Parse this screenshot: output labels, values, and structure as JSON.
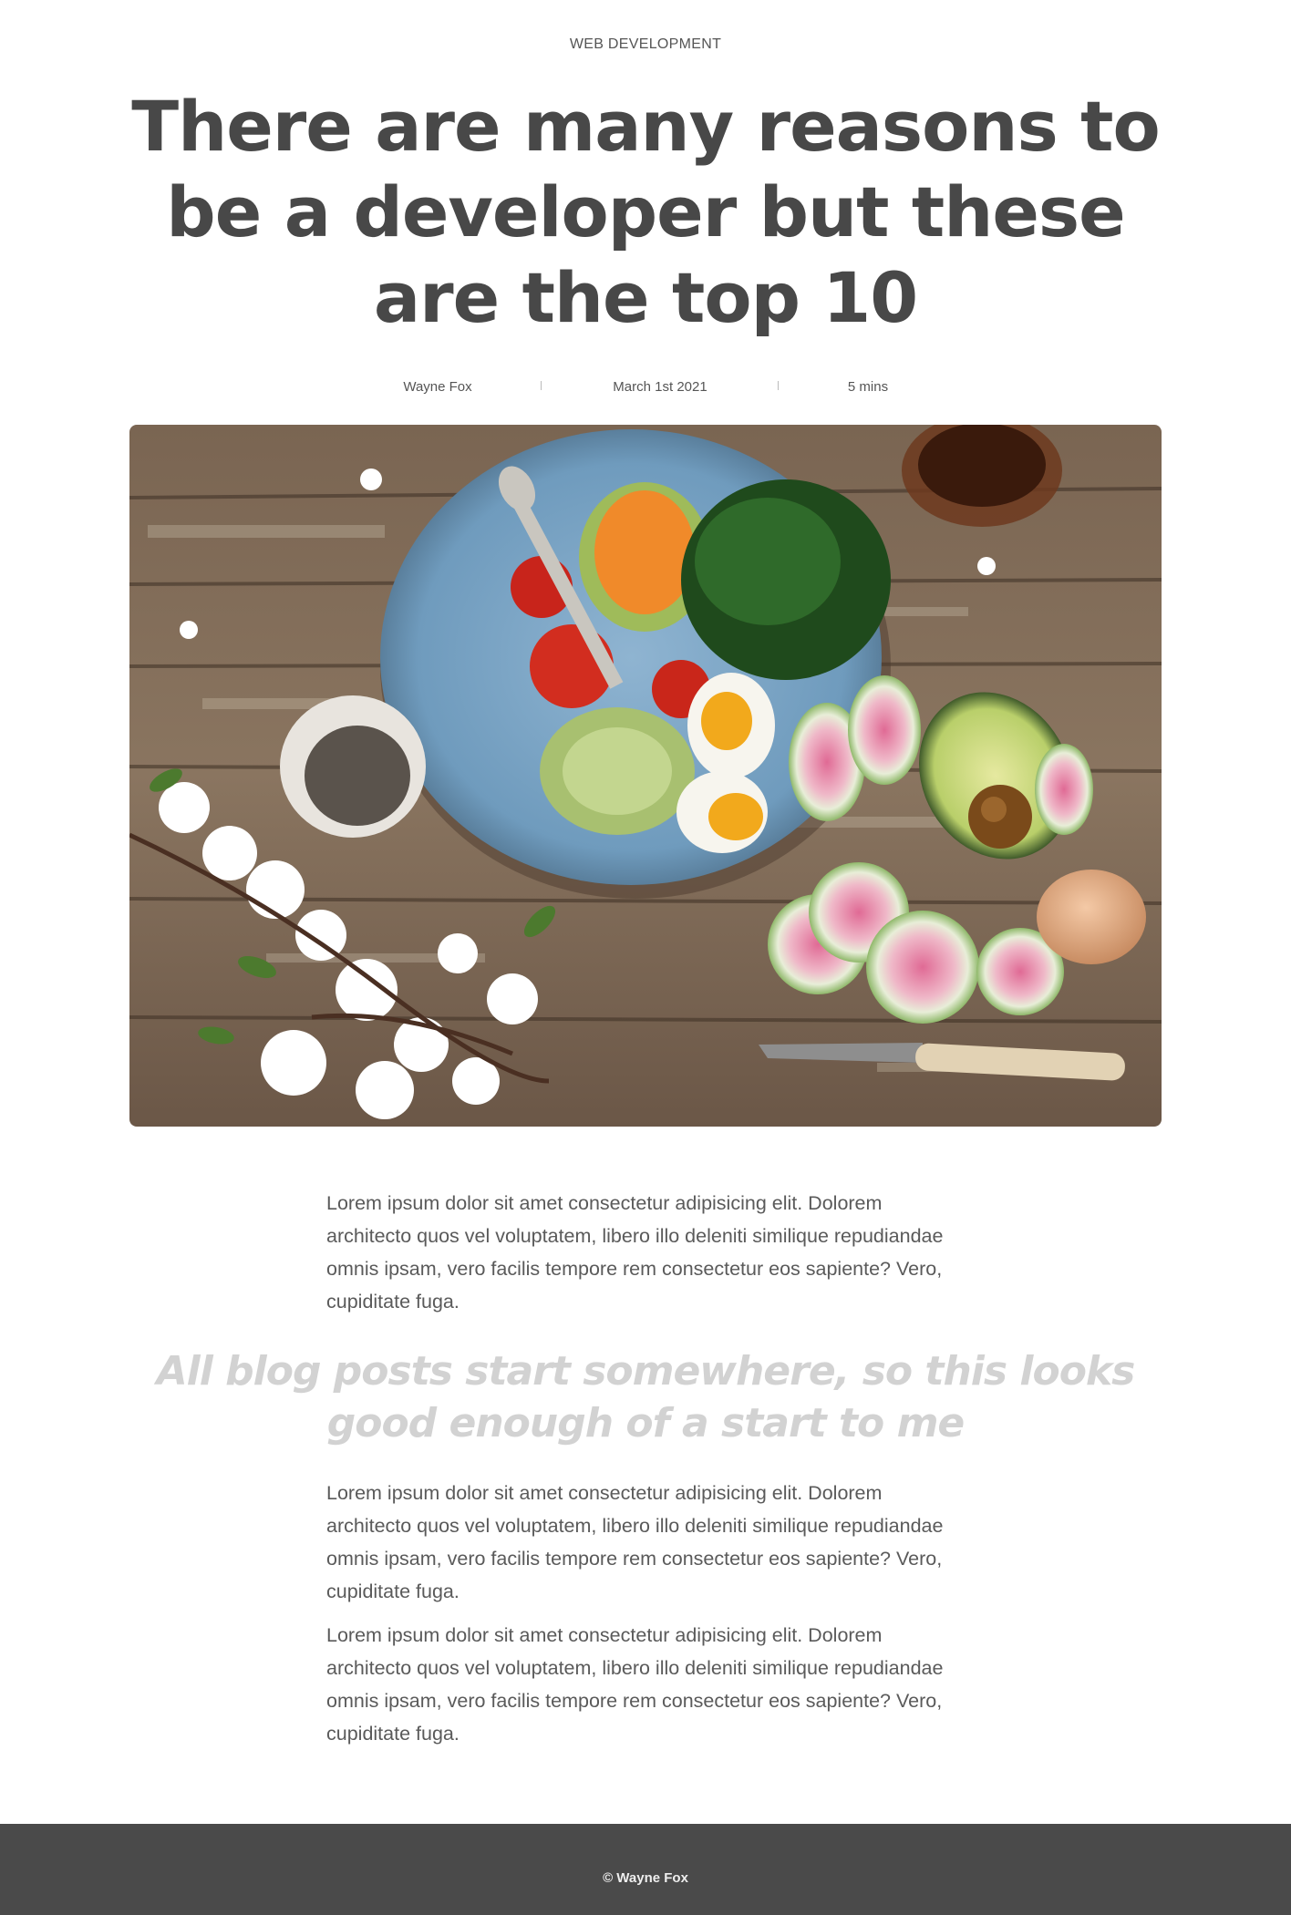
{
  "article": {
    "category": "WEB DEVELOPMENT",
    "title": "There are many reasons to be a developer but these are the top 10",
    "meta": {
      "author": "Wayne Fox",
      "date": "March 1st 2021",
      "read_time": "5 mins"
    },
    "hero_image_icon": "food-bowl-photo"
  },
  "body": {
    "paragraph_1": "Lorem ipsum dolor sit amet consectetur adipisicing elit. Dolorem architecto quos vel voluptatem, libero illo deleniti similique repudiandae omnis ipsam, vero facilis tempore rem consectetur eos sapiente? Vero, cupiditate fuga.",
    "pull_quote": "All blog posts start somewhere, so this looks good enough of a start to me",
    "paragraph_2": "Lorem ipsum dolor sit amet consectetur adipisicing elit. Dolorem architecto quos vel voluptatem, libero illo deleniti similique repudiandae omnis ipsam, vero facilis tempore rem consectetur eos sapiente? Vero, cupiditate fuga.",
    "paragraph_3": "Lorem ipsum dolor sit amet consectetur adipisicing elit. Dolorem architecto quos vel voluptatem, libero illo deleniti similique repudiandae omnis ipsam, vero facilis tempore rem consectetur eos sapiente? Vero, cupiditate fuga."
  },
  "footer": {
    "copyright": "© Wayne Fox"
  },
  "colors": {
    "text": "#4a4a4a",
    "quote": "#d2d2d2",
    "footer_bg": "#4a4a4a"
  }
}
